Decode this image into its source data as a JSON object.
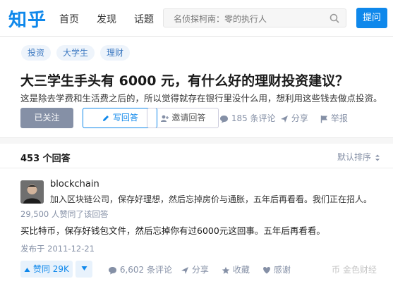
{
  "header": {
    "logo": "知乎",
    "nav": [
      "首页",
      "发现",
      "话题"
    ],
    "search_placeholder": "名侦探柯南：零的执行人",
    "ask_label": "提问"
  },
  "question": {
    "tags": [
      "投资",
      "大学生",
      "理财"
    ],
    "title": "大三学生手头有 6000 元，有什么好的理财投资建议？",
    "description": "这是除去学费和生活费之后的，所以觉得就存在银行里没什么用，想利用这些钱去做点投资。",
    "follow_label": "已关注",
    "write_label": "写回答",
    "invite_label": "邀请回答",
    "comments_label": "185 条评论",
    "share_label": "分享",
    "report_label": "举报"
  },
  "answers": {
    "count_label": "453 个回答",
    "sort_label": "默认排序",
    "first": {
      "author": "blockchain",
      "bio": "加入区块链公司，保存好理想，然后忘掉房价与通胀，五年后再看看。我们正在招人。",
      "votes_text": "29,500 人赞同了该回答",
      "content": "买比特币，保存好钱包文件，然后忘掉你有过6000元这回事。五年后再看看。",
      "date": "发布于 2011-12-21",
      "upvote_label": "赞同 29K",
      "comments_label": "6,602 条评论",
      "share_label": "分享",
      "collect_label": "收藏",
      "thanks_label": "感谢"
    }
  },
  "watermark": "币 金色财经",
  "colors": {
    "brand": "#0f88eb",
    "muted": "#8590a6",
    "tag_bg": "#eef4fb"
  }
}
